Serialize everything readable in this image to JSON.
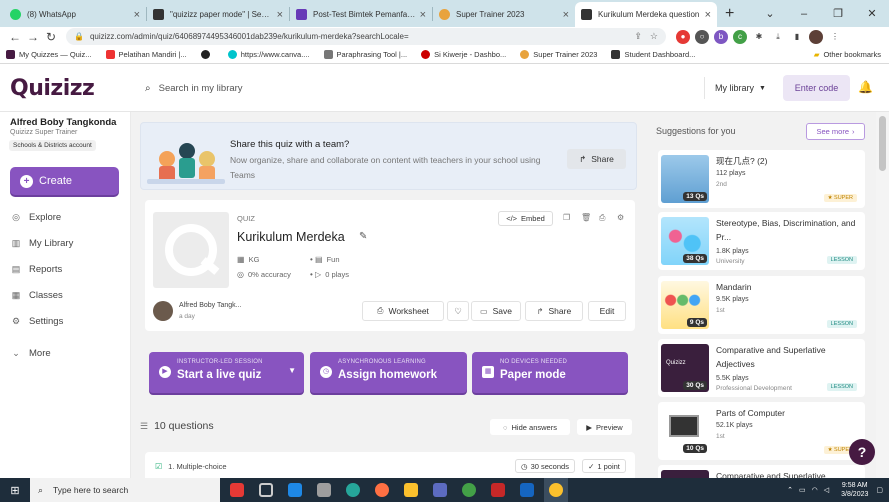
{
  "browser": {
    "tabs": [
      {
        "title": "(8) WhatsApp",
        "color": "#25d366"
      },
      {
        "title": "\"quizizz paper mode\" | Search",
        "color": "#333333"
      },
      {
        "title": "Post-Test Bimtek Pemanfaatan",
        "color": "#673ab7"
      },
      {
        "title": "Super Trainer 2023",
        "color": "#e8a33d"
      },
      {
        "title": "Kurikulum Merdeka question",
        "color": "#333333",
        "active": true
      }
    ],
    "new_tab": "+",
    "url": "quizizz.com/admin/quiz/64068974495346001dab239e/kurikulum-merdeka?searchLocale=",
    "bookmarks": [
      {
        "label": "My Quizzes — Quiz...",
        "color": "#461a42"
      },
      {
        "label": "Pelatihan Mandiri |...",
        "color": "#e33"
      },
      {
        "label": "",
        "color": "#222"
      },
      {
        "label": "https://www.canva....",
        "color": "#00c4cc"
      },
      {
        "label": "Paraphrasing Tool |...",
        "color": "#777"
      },
      {
        "label": "Si Kiwerje - Dashbo...",
        "color": "#c00"
      },
      {
        "label": "Super Trainer 2023",
        "color": "#e8a33d"
      },
      {
        "label": "Student Dashboard...",
        "color": "#333"
      }
    ],
    "other_bookmarks": "Other bookmarks"
  },
  "app": {
    "logo": "Quizizz",
    "search_placeholder": "Search in my library",
    "my_library": "My library",
    "enter_code": "Enter code"
  },
  "sidebar": {
    "user_name": "Alfred Boby Tangkonda",
    "user_role": "Quizizz Super Trainer",
    "account": "Schools & Districts account",
    "create": "Create",
    "nav": [
      {
        "label": "Explore",
        "icon": "compass-icon"
      },
      {
        "label": "My Library",
        "icon": "library-icon"
      },
      {
        "label": "Reports",
        "icon": "reports-icon"
      },
      {
        "label": "Classes",
        "icon": "classes-icon"
      },
      {
        "label": "Settings",
        "icon": "settings-icon"
      },
      {
        "label": "More",
        "icon": "chevron-down-icon"
      }
    ]
  },
  "share": {
    "title": "Share this quiz with a team?",
    "desc": "Now organize, share and collaborate on content with teachers in your school using Teams",
    "button": "Share"
  },
  "quiz": {
    "label": "QUIZ",
    "title": "Kurikulum Merdeka",
    "embed": "Embed",
    "grade": "KG",
    "subject": "Fun",
    "accuracy": "0% accuracy",
    "plays": "0 plays",
    "author": "Alfred Boby Tangk...",
    "time": "a day",
    "actions": {
      "worksheet": "Worksheet",
      "save": "Save",
      "share": "Share",
      "edit": "Edit"
    }
  },
  "modes": [
    {
      "sub": "INSTRUCTOR-LED SESSION",
      "title": "Start a live quiz"
    },
    {
      "sub": "ASYNCHRONOUS LEARNING",
      "title": "Assign homework"
    },
    {
      "sub": "NO DEVICES NEEDED",
      "title": "Paper mode"
    }
  ],
  "questions": {
    "count": "10 questions",
    "hide_answers": "Hide answers",
    "preview": "Preview",
    "first": "1. Multiple-choice",
    "first_time": "30 seconds",
    "first_points": "1 point"
  },
  "suggestions": {
    "header": "Suggestions for you",
    "see_more": "See more",
    "items": [
      {
        "title": "现在几点?  (2)",
        "plays": "112 plays",
        "grade": "2nd",
        "qs": "13 Qs",
        "badge": "SUPER",
        "badge_type": "super",
        "thumb": "#6aa9d8"
      },
      {
        "title": "Stereotype, Bias, Discrimination, and Pr...",
        "plays": "1.8K plays",
        "grade": "University",
        "qs": "38 Qs",
        "badge": "LESSON",
        "badge_type": "lesson",
        "thumb": "#3fa7d6"
      },
      {
        "title": "Mandarin",
        "plays": "9.5K plays",
        "grade": "1st",
        "qs": "9 Qs",
        "badge": "LESSON",
        "badge_type": "lesson",
        "thumb": "#f4d35e"
      },
      {
        "title": "Comparative and Superlative Adjectives",
        "plays": "5.5K plays",
        "grade": "Professional Development",
        "qs": "30 Qs",
        "badge": "LESSON",
        "badge_type": "lesson",
        "thumb": "#3a1f3d"
      },
      {
        "title": "Parts of Computer",
        "plays": "52.1K plays",
        "grade": "1st",
        "qs": "10 Qs",
        "badge": "SUPER",
        "badge_type": "super",
        "thumb": "#dcdcdc"
      },
      {
        "title": "Comparative and Superlative",
        "plays": "",
        "grade": "",
        "qs": "",
        "badge": "",
        "badge_type": "",
        "thumb": "#3a1f3d"
      }
    ]
  },
  "taskbar": {
    "search": "Type here to search",
    "time": "9:58 AM",
    "date": "3/8/2023"
  }
}
